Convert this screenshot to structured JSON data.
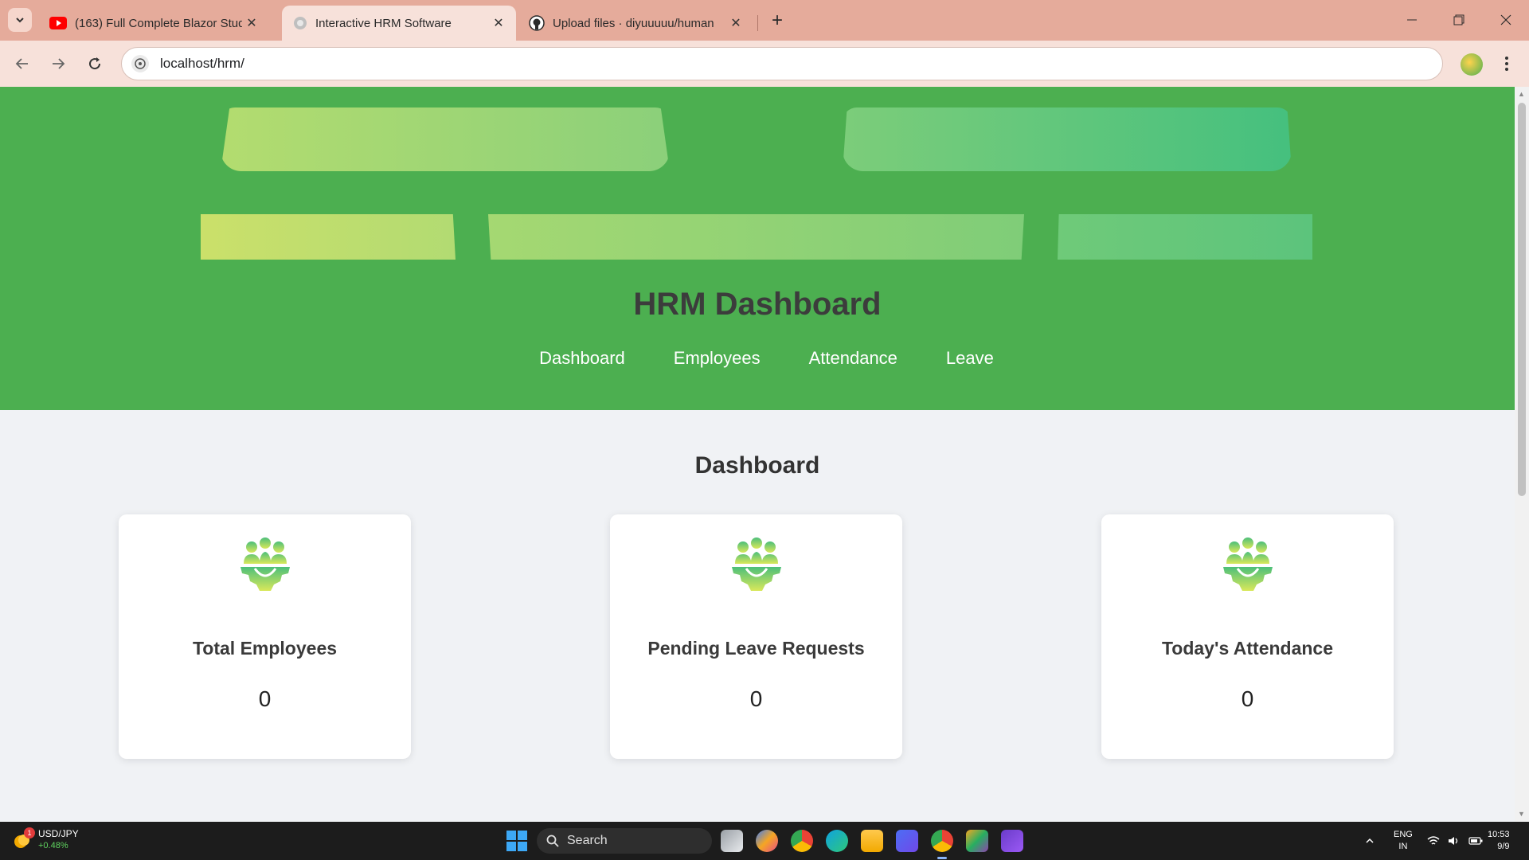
{
  "browser": {
    "tabs": [
      {
        "title": "(163) Full Complete Blazor Stud",
        "icon": "youtube-icon",
        "active": false
      },
      {
        "title": "Interactive HRM Software",
        "icon": "globe-icon",
        "active": true
      },
      {
        "title": "Upload files · diyuuuuu/human",
        "icon": "github-icon",
        "active": false
      }
    ],
    "url": "localhost/hrm/"
  },
  "header": {
    "title": "HRM Dashboard",
    "nav": [
      "Dashboard",
      "Employees",
      "Attendance",
      "Leave"
    ],
    "colors": {
      "background": "#4caf50",
      "accent_light": "#c8e06a",
      "accent_teal": "#45c07e"
    }
  },
  "main": {
    "section_title": "Dashboard",
    "cards": [
      {
        "label": "Total Employees",
        "value": "0",
        "icon": "team-gear-icon"
      },
      {
        "label": "Pending Leave Requests",
        "value": "0",
        "icon": "team-gear-icon"
      },
      {
        "label": "Today's Attendance",
        "value": "0",
        "icon": "team-gear-icon"
      }
    ]
  },
  "taskbar": {
    "ticker": {
      "name": "USD/JPY",
      "change": "+0.48%",
      "badge": "1"
    },
    "search_label": "Search",
    "language": {
      "line1": "ENG",
      "line2": "IN"
    },
    "clock": {
      "time": "10:53",
      "date": "9/9"
    }
  }
}
